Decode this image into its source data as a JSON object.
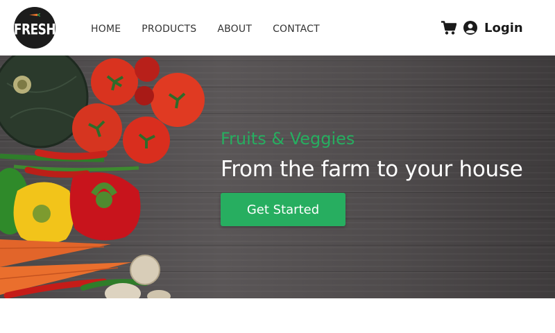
{
  "brand": {
    "logo_text": "FRESH",
    "logo_bg": "#1c1c1c"
  },
  "nav": {
    "items": [
      {
        "label": "HOME"
      },
      {
        "label": "PRODUCTS"
      },
      {
        "label": "ABOUT"
      },
      {
        "label": "CONTACT"
      }
    ]
  },
  "actions": {
    "cart_icon": "shopping-cart-icon",
    "user_icon": "user-circle-icon",
    "login_label": "Login"
  },
  "hero": {
    "subtitle": "Fruits & Veggies",
    "title": "From the farm to your house",
    "cta_label": "Get Started",
    "accent_color": "#27ae60",
    "background": "dark wood with vegetables"
  }
}
